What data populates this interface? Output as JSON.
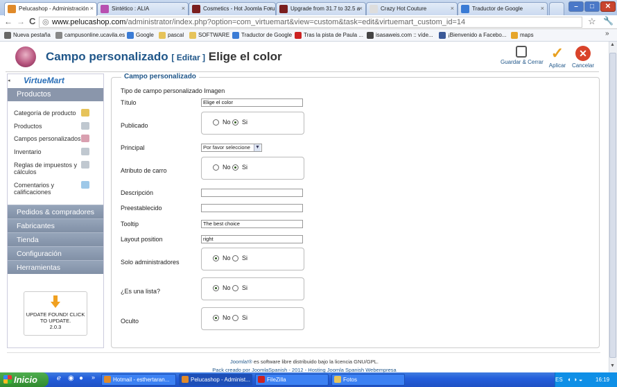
{
  "browser": {
    "tabs": [
      {
        "title": "Pelucashop - Administración",
        "favicon_color": "#e08a2a",
        "active": true
      },
      {
        "title": "Sintético : ALIA",
        "favicon_color": "#b84fb0"
      },
      {
        "title": "Cosmetics - Hot Joomla Foru",
        "favicon_color": "#7a1e1e"
      },
      {
        "title": "Upgrade from 31.7 to 32.5 a",
        "favicon_color": "#7a1e1e"
      },
      {
        "title": "Crazy Hot Couture",
        "favicon_color": "#dddddd"
      },
      {
        "title": "Traductor de Google",
        "favicon_color": "#3a7bd5"
      }
    ],
    "url_domain": "www.pelucashop.com",
    "url_path": "/administrator/index.php?option=com_virtuemart&view=custom&task=edit&virtuemart_custom_id=14",
    "bookmarks": [
      {
        "label": "Nueva pestaña",
        "color": "#666666"
      },
      {
        "label": "campusonline.ucavila.es",
        "color": "#888888"
      },
      {
        "label": "Google",
        "color": "#3a7bd5"
      },
      {
        "label": "pascal",
        "color": "#e6c35a"
      },
      {
        "label": "SOFTWARE",
        "color": "#e6c35a"
      },
      {
        "label": "Traductor de Google",
        "color": "#3a7bd5"
      },
      {
        "label": "Tras la pista de Paula ...",
        "color": "#cc2222"
      },
      {
        "label": "isasaweis.com :: víde...",
        "color": "#444444"
      },
      {
        "label": "¡Bienvenido a Facebo...",
        "color": "#3b5998"
      },
      {
        "label": "maps",
        "color": "#e6a52a"
      }
    ]
  },
  "header": {
    "title": "Campo personalizado",
    "edit_tag": "[ Editar ]",
    "item_name": "Elige el color",
    "buttons": [
      {
        "label": "Guardar & Cerrar",
        "icon": "save-icon",
        "color": "#555555"
      },
      {
        "label": "Aplicar",
        "icon": "check-icon",
        "color": "#e8a020"
      },
      {
        "label": "Cancelar",
        "icon": "cancel-icon",
        "color": "#d9432a"
      }
    ]
  },
  "sidebar": {
    "logo_text": "VirtueMart",
    "section_title": "Productos",
    "items": [
      {
        "label": "Categoría de producto",
        "icon_color": "#e6c35a"
      },
      {
        "label": "Productos",
        "icon_color": "#c0c8d0"
      },
      {
        "label": "Campos personalizados",
        "icon_color": "#d9a0b0"
      },
      {
        "label": "Inventario",
        "icon_color": "#c0c8d0"
      },
      {
        "label": "Reglas de impuestos y cálculos",
        "icon_color": "#c0c8d0"
      },
      {
        "label": "Comentarios y calificaciones",
        "icon_color": "#9ec8e8"
      }
    ],
    "sections": [
      "Pedidos & compradores",
      "Fabricantes",
      "Tienda",
      "Configuración",
      "Herramientas"
    ],
    "update_box": {
      "line1": "UPDATE FOUND! CLICK TO UPDATE.",
      "version": "2.0.3"
    }
  },
  "form": {
    "legend": "Campo personalizado",
    "type_label": "Tipo de campo personalizado",
    "type_value": "Imagen",
    "title_label": "Título",
    "title_value": "Elige el color",
    "published_label": "Publicado",
    "principal_label": "Principal",
    "principal_value": "Por favor seleccione",
    "cart_attr_label": "Atributo de carro",
    "description_label": "Descripción",
    "description_value": "",
    "default_label": "Preestablecido",
    "default_value": "",
    "tooltip_label": "Tooltip",
    "tooltip_value": "The best choice",
    "layout_label": "Layout position",
    "layout_value": "right",
    "admin_only_label": "Solo administradores",
    "is_list_label": "¿Es una lista?",
    "hidden_label": "Oculto",
    "no_label": "No",
    "yes_label": "Si"
  },
  "radios": {
    "published": "yes",
    "cart_attr": "yes",
    "admin_only": "no",
    "is_list": "no",
    "hidden": "no"
  },
  "footer": {
    "joomla_link": "Joomla!®",
    "license_text": " es software libre distribuido bajo la licencia GNU/GPL.",
    "line2": "Pack creado por JoomlaSpanish - 2012 - Hosting Joomla Spanish Webempresa"
  },
  "taskbar": {
    "start_label": "Inicio",
    "tasks": [
      {
        "label": "Hotmail - esthertaran...",
        "color": "#e08a2a"
      },
      {
        "label": "Pelucashop - Administ...",
        "color": "#e08a2a",
        "active": true
      },
      {
        "label": "FileZilla",
        "color": "#cc2222"
      },
      {
        "label": "Fotos",
        "color": "#e6c35a"
      }
    ],
    "lang": "ES",
    "time": "16:19"
  }
}
